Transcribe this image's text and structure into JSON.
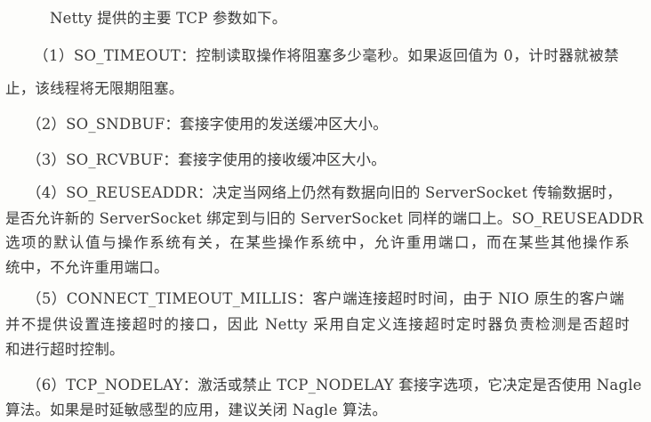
{
  "intro": "Netty 提供的主要 TCP 参数如下。",
  "paragraphs": [
    {
      "lines": [
        "（1）SO_TIMEOUT：控制读取操作将阻塞多少毫秒。如果返回值为 0，计时器就被禁",
        "止，该线程将无限期阻塞。"
      ]
    },
    {
      "lines": [
        "（2）SO_SNDBUF：套接字使用的发送缓冲区大小。"
      ]
    },
    {
      "lines": [
        "（3）SO_RCVBUF：套接字使用的接收缓冲区大小。"
      ]
    },
    {
      "lines": [
        "（4）SO_REUSEADDR：决定当网络上仍然有数据向旧的 ServerSocket 传输数据时，",
        "是否允许新的 ServerSocket 绑定到与旧的 ServerSocket 同样的端口上。SO_REUSEADDR",
        "选项的默认值与操作系统有关，在某些操作系统中，允许重用端口，而在某些其他操作系",
        "统中，不允许重用端口。"
      ]
    },
    {
      "lines": [
        "（5）CONNECT_TIMEOUT_MILLIS：客户端连接超时时间，由于 NIO 原生的客户端",
        "并不提供设置连接超时的接口，因此 Netty 采用自定义连接超时定时器负责检测是否超时",
        "和进行超时控制。"
      ]
    },
    {
      "lines": [
        "（6）TCP_NODELAY：激活或禁止 TCP_NODELAY 套接字选项，它决定是否使用 Nagle",
        "算法。如果是时延敏感型的应用，建议关闭 Nagle 算法。"
      ]
    }
  ]
}
